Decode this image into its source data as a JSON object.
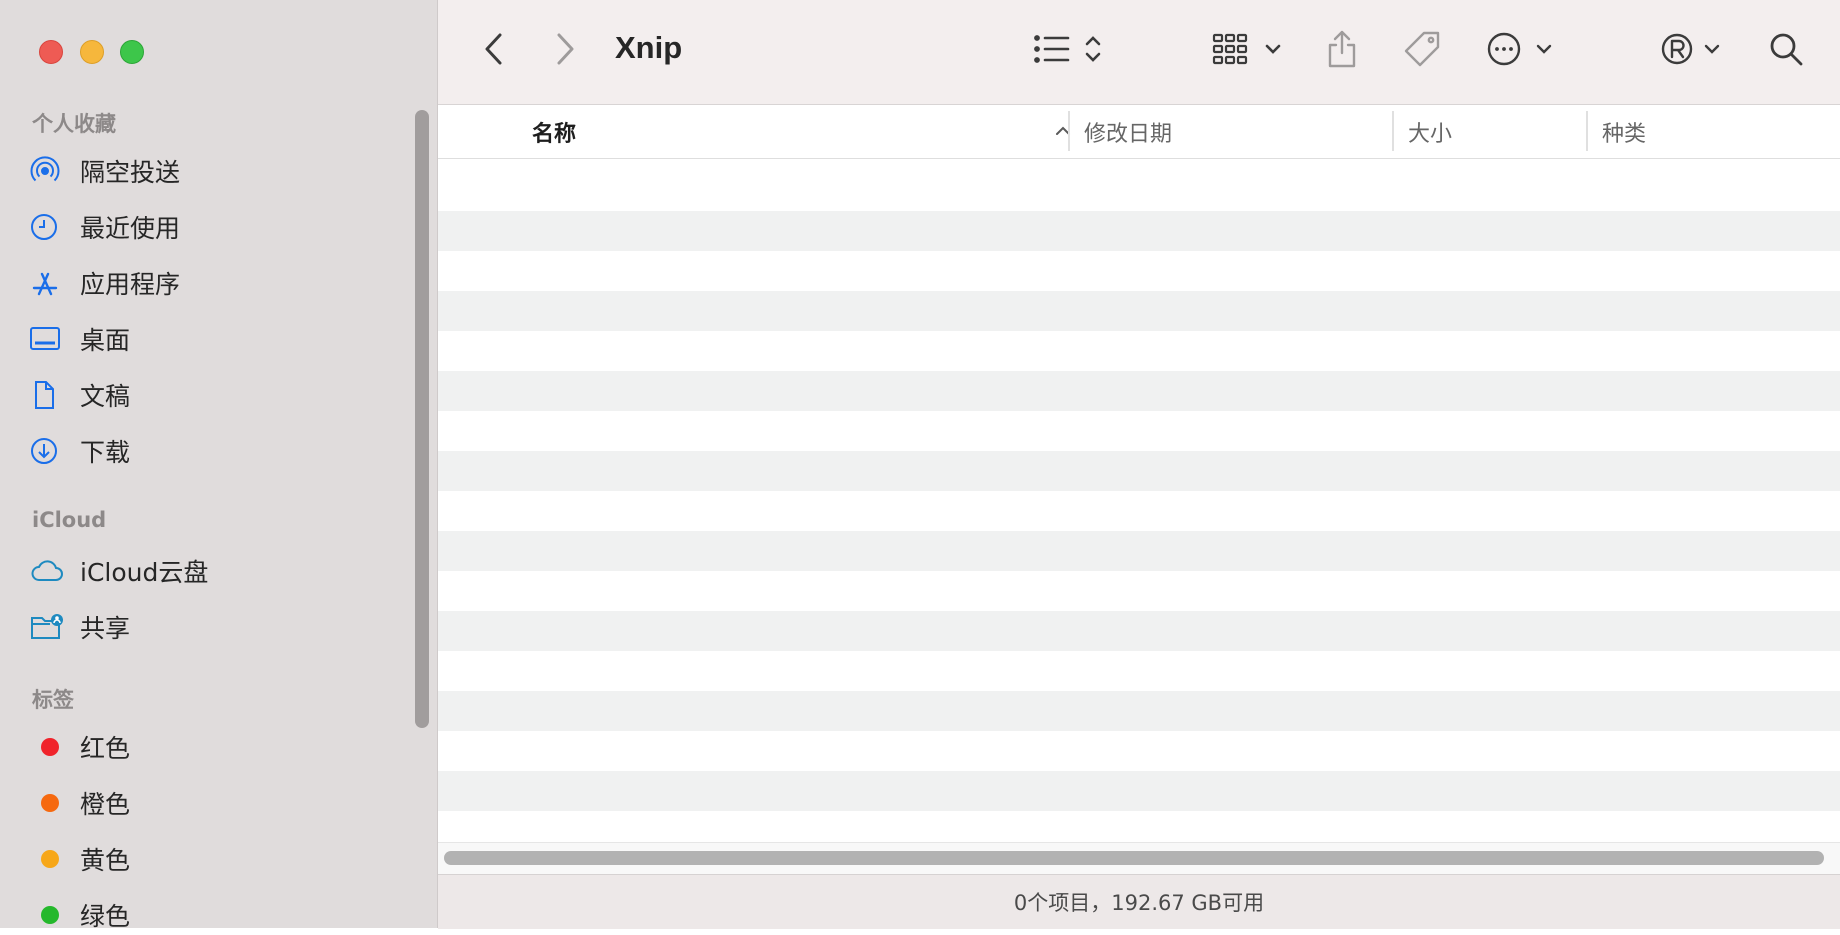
{
  "window": {
    "title": "Xnip"
  },
  "sidebar": {
    "favorites_label": "个人收藏",
    "favorites": [
      {
        "label": "隔空投送",
        "icon": "airdrop-icon"
      },
      {
        "label": "最近使用",
        "icon": "clock-icon"
      },
      {
        "label": "应用程序",
        "icon": "applications-icon"
      },
      {
        "label": "桌面",
        "icon": "desktop-icon"
      },
      {
        "label": "文稿",
        "icon": "document-icon"
      },
      {
        "label": "下载",
        "icon": "download-icon"
      }
    ],
    "icloud_label": "iCloud",
    "icloud": [
      {
        "label": "iCloud云盘",
        "icon": "cloud-icon"
      },
      {
        "label": "共享",
        "icon": "shared-folder-icon"
      }
    ],
    "tags_label": "标签",
    "tags": [
      {
        "label": "红色",
        "color": "#f0232b"
      },
      {
        "label": "橙色",
        "color": "#f6690f"
      },
      {
        "label": "黄色",
        "color": "#f7a719"
      },
      {
        "label": "绿色",
        "color": "#25b82c"
      }
    ]
  },
  "toolbar": {
    "icons": [
      "back-chevron-icon",
      "forward-chevron-icon",
      "list-view-icon",
      "group-view-icon",
      "share-icon",
      "tag-icon",
      "more-actions-icon",
      "registered-extension-icon",
      "search-icon"
    ]
  },
  "columns": {
    "name": "名称",
    "modified": "修改日期",
    "size": "大小",
    "kind": "种类"
  },
  "status": {
    "text": "0个项目，192.67 GB可用"
  },
  "colors": {
    "accent": "#1a6ee9",
    "sidebar_bg": "#e0dcdc",
    "toolbar_bg": "#f3eeee"
  }
}
